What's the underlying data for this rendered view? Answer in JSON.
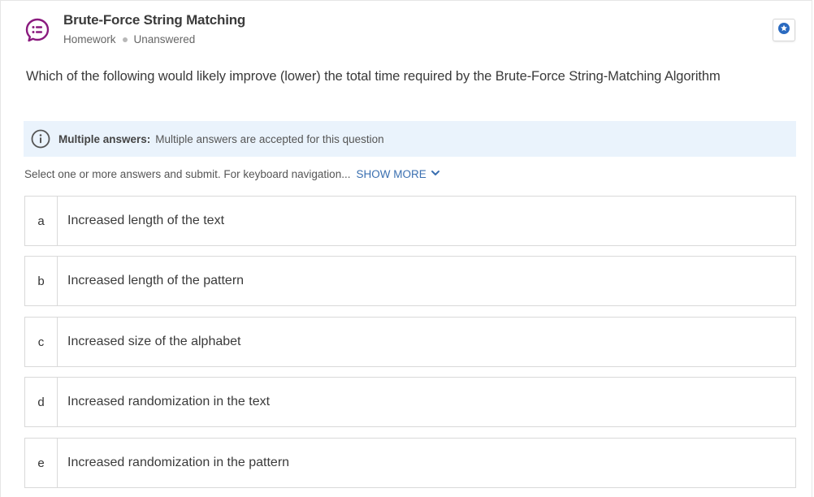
{
  "header": {
    "title": "Brute-Force String Matching",
    "type": "Homework",
    "status": "Unanswered",
    "icon": "discussion-question-icon",
    "icon_color": "#8a1a7e"
  },
  "question": {
    "text": "Which of the following would likely improve (lower) the total time required by the Brute-Force String-Matching Algorithm"
  },
  "info": {
    "label": "Multiple answers:",
    "text": "Multiple answers are accepted for this question",
    "background": "#eaf3fc"
  },
  "instructions": {
    "text": "Select one or more answers and submit. For keyboard navigation...",
    "show_more": "SHOW MORE"
  },
  "options": [
    {
      "letter": "a",
      "text": "Increased length of the text"
    },
    {
      "letter": "b",
      "text": "Increased length of the pattern"
    },
    {
      "letter": "c",
      "text": "Increased size of the alphabet"
    },
    {
      "letter": "d",
      "text": "Increased randomization in the text"
    },
    {
      "letter": "e",
      "text": "Increased randomization in the pattern"
    }
  ],
  "accent_color": "#3a6fb0",
  "star_color": "#2a6ac0"
}
